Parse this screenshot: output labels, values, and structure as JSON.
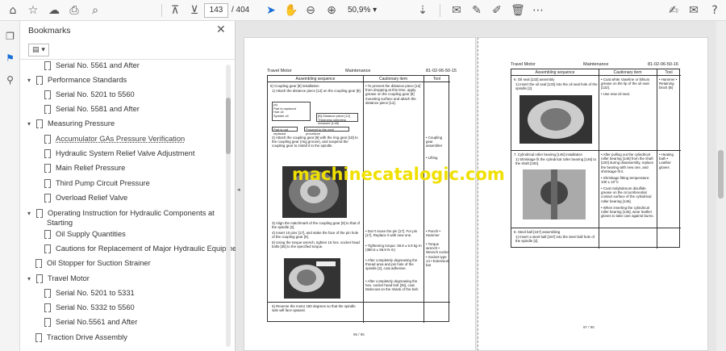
{
  "toolbar": {
    "page_current": "143",
    "page_total": "/ 404",
    "zoom": "50,9%",
    "zoom_caret": "▾"
  },
  "panel": {
    "title": "Bookmarks",
    "close": "✕",
    "options": "▤ ▾"
  },
  "bookmarks": [
    {
      "label": "Serial No. 5561 and After",
      "level": 2,
      "chevron": ""
    },
    {
      "label": "Performance Standards",
      "level": 1,
      "chevron": "▾"
    },
    {
      "label": "Serial No. 5201 to 5560",
      "level": 2,
      "chevron": ""
    },
    {
      "label": "Serial No. 5581 and After",
      "level": 2,
      "chevron": ""
    },
    {
      "label": "Measuring Pressure",
      "level": 1,
      "chevron": "▾"
    },
    {
      "label": "Accumulator GAs Pressure Verification",
      "level": 2,
      "chevron": "",
      "link": true
    },
    {
      "label": "Hydraulic System Relief Valve Adjustment",
      "level": 2,
      "chevron": ""
    },
    {
      "label": "Main Relief Pressure",
      "level": 2,
      "chevron": ""
    },
    {
      "label": "Third Pump Circuit Pressure",
      "level": 2,
      "chevron": ""
    },
    {
      "label": "Overload Relief Valve",
      "level": 2,
      "chevron": ""
    },
    {
      "label": "Operating Instruction for Hydraulic Components at",
      "label2": "Starting",
      "level": 1,
      "chevron": "▾"
    },
    {
      "label": "Oil Supply Quantities",
      "level": 2,
      "chevron": ""
    },
    {
      "label": "Cautions for Replacement of Major Hydraulic Equipment",
      "level": 2,
      "chevron": ""
    },
    {
      "label": "Oil Stopper for Suction Strainer",
      "level": 1,
      "chevron": ""
    },
    {
      "label": "Travel Motor",
      "level": 1,
      "chevron": "▾"
    },
    {
      "label": "Serial No. 5201 to 5331",
      "level": 2,
      "chevron": ""
    },
    {
      "label": "Serial No. 5332 to 5560",
      "level": 2,
      "chevron": ""
    },
    {
      "label": "Serial No.5561 and After",
      "level": 2,
      "chevron": ""
    },
    {
      "label": "Traction Drive Assembly",
      "level": 1,
      "chevron": ""
    }
  ],
  "page_left": {
    "header_left": "Travel Motor",
    "header_mid": "Maintenance",
    "header_right": "81-02-06-50-15",
    "col1": "Assembling sequence",
    "col2": "Cautionary item",
    "col3": "Tool",
    "step5": "5) Coupling gear [9] installation",
    "step5a": "1) Attach the distance piece [12] on the coupling gear [9].",
    "caution5": "• To prevent the distance piece [12] from dropping at this time, apply grease on the coupling gear [9] mounting surface and attach the distance piece [12].",
    "step5b": "2) Attach the coupling gear [9] with the ring gear [18] to the coupling gear (ring groove), and suspend the coupling gear to install it to the spindle.",
    "tool5b": "• Coupling gear assembler",
    "tool5c": "• Lifting",
    "step5c": "3) Align the matchmark of the coupling gear [9] to that of the spindle [2].",
    "step5d": "4) Insert 10 pins [17], and stake the face of the pin hole of the coupling gear [9].",
    "step5e": "5) Using the torque wrench, tighten 16 hex. socket head bolts [35] to the specified torque.",
    "caution5d": "• Don't reuse the pin [17]. For pin [17], Replace it with new one.",
    "caution5e": "• Tightening torque: 38.8 ± 5.9 kg·m (380.6 ± 58.8 N·m)",
    "caution5f": "• After completely degreasing the thread area and pin hole of the spindle [2], coat adhesive.",
    "caution5g": "• After completely degreasing the hex. socket head bolt [35], coat Molecoat on the shank of the bolt.",
    "tool5d": "• Punch • Hammer",
    "tool5e": "• Torque wrench • Wrench socket • Socket type 14 • Extension bar",
    "step6": "6) Reverse the motor 180 degrees so that the spindle side will face upward.",
    "diag_a": "(a)",
    "diag_b": "Part is replaced",
    "diag_c": "Hub oil",
    "diag_d": "Spindle oil",
    "diag_e": "Ball bearing [24]",
    "diag_f": "[B] Distance piece [12]",
    "diag_g": "Thickness selecting measure (f-dif)",
    "diag_h": "Part is not replaced",
    "diag_i": "Proceed to the next procedure",
    "footer": "96 / 95"
  },
  "page_right": {
    "header_left": "Travel Motor",
    "header_mid": "Maintenance",
    "header_right": "81-02-06-50-16",
    "col1": "Assembling sequence",
    "col2": "Cautionary item",
    "col3": "Tool",
    "step6": "6. Oil seal [132] assembly",
    "step6a": "1) Insert the oil seal [132] into the oil seal hole of the spindle [2].",
    "caution6": "• Coat white Vaseline or lithium grease on the lip of the oil seal [132].",
    "caution6b": "• Use new oil seal.",
    "tool6": "• Hammer • Retaining block (B)",
    "step7": "7. Cylindrical roller bearing [146] installation",
    "step7a": "1) Shrinkage fit the cylindrical roller bearing [146] to the shaft [100].",
    "caution7": "• After pulling out the cylindrical roller bearing [146] from the shaft [100] during disassembly, replace the bearing with new one, and shrinkage-fit it.",
    "caution7b": "• Shrinkage fitting temperature: 100 ± 10°C",
    "caution7c": "• Coat molybdenum disulfide grease on the circumferential contact surface of the cylindrical roller bearing [146].",
    "caution7d": "• When inserting the cylindrical roller bearing [146], wear leather gloves to take care against burns.",
    "tool7": "• Heating bath • Leather gloves",
    "step8": "8. Steel ball [167] assembling",
    "step8a": "1) Insert a steel ball [167] into the steel ball hole of the spindle [2].",
    "footer": "97 / 95"
  },
  "watermark": "machinecatalogic.com",
  "side_mark": "◂"
}
